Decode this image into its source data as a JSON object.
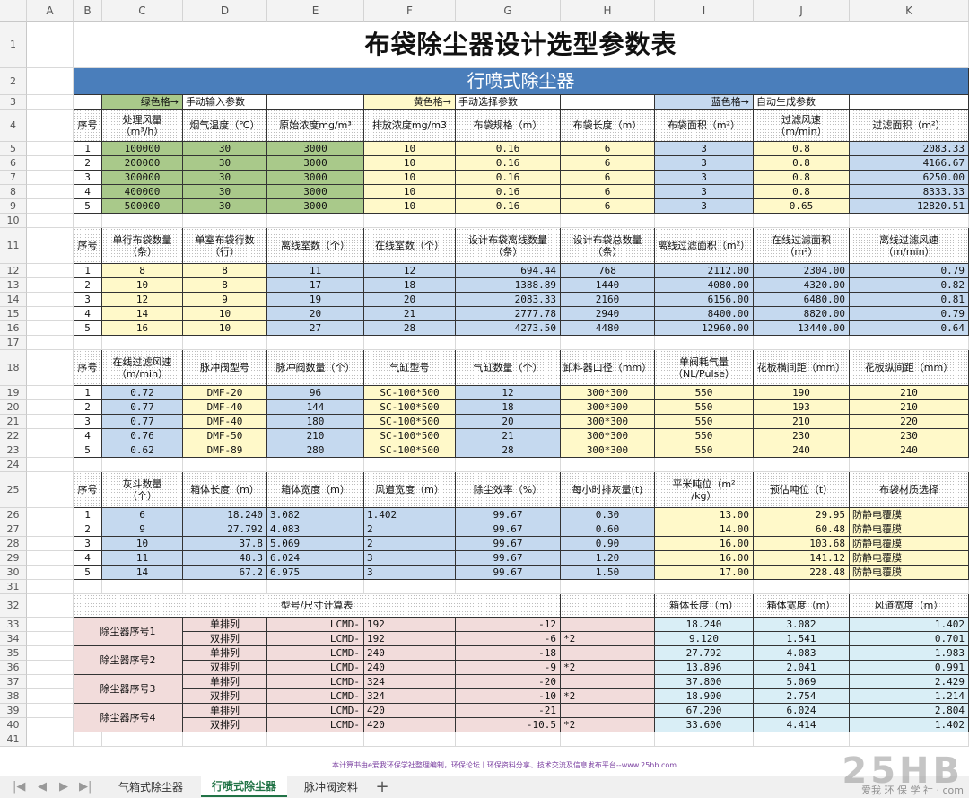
{
  "columns": [
    "A",
    "B",
    "C",
    "D",
    "E",
    "F",
    "G",
    "H",
    "I",
    "J",
    "K"
  ],
  "rows": [
    "1",
    "2",
    "3",
    "4",
    "5",
    "6",
    "7",
    "8",
    "9",
    "10",
    "11",
    "12",
    "13",
    "14",
    "15",
    "16",
    "17",
    "18",
    "19",
    "20",
    "21",
    "22",
    "23",
    "24",
    "25",
    "26",
    "27",
    "28",
    "29",
    "30",
    "31",
    "32",
    "33",
    "34",
    "35",
    "36",
    "37",
    "38",
    "39",
    "40",
    "41"
  ],
  "title": "布袋除尘器设计选型参数表",
  "banner": "行喷式除尘器",
  "legend": {
    "green_label": "绿色格→",
    "green_text": "手动输入参数",
    "yellow_label": "黄色格→",
    "yellow_text": "手动选择参数",
    "blue_label": "蓝色格→",
    "blue_text": "自动生成参数"
  },
  "table1": {
    "headers": [
      "序号",
      "处理风量\n（m³/h）",
      "烟气温度（℃）",
      "原始浓度mg/m³",
      "排放浓度mg/m3",
      "布袋规格（m）",
      "布袋长度（m）",
      "布袋面积（m²）",
      "过滤风速\n（m/min）",
      "过滤面积（m²）"
    ],
    "rows": [
      [
        "1",
        "100000",
        "30",
        "3000",
        "10",
        "0.16",
        "6",
        "3",
        "0.8",
        "2083.33"
      ],
      [
        "2",
        "200000",
        "30",
        "3000",
        "10",
        "0.16",
        "6",
        "3",
        "0.8",
        "4166.67"
      ],
      [
        "3",
        "300000",
        "30",
        "3000",
        "10",
        "0.16",
        "6",
        "3",
        "0.8",
        "6250.00"
      ],
      [
        "4",
        "400000",
        "30",
        "3000",
        "10",
        "0.16",
        "6",
        "3",
        "0.8",
        "8333.33"
      ],
      [
        "5",
        "500000",
        "30",
        "3000",
        "10",
        "0.16",
        "6",
        "3",
        "0.65",
        "12820.51"
      ]
    ]
  },
  "table2": {
    "headers": [
      "序号",
      "单行布袋数量\n（条）",
      "单室布袋行数\n（行）",
      "离线室数（个）",
      "在线室数（个）",
      "设计布袋离线数量\n（条）",
      "设计布袋总数量\n（条）",
      "离线过滤面积（m²）",
      "在线过滤面积\n（m²）",
      "离线过滤风速\n（m/min）"
    ],
    "rows": [
      [
        "1",
        "8",
        "8",
        "11",
        "12",
        "694.44",
        "768",
        "2112.00",
        "2304.00",
        "0.79"
      ],
      [
        "2",
        "10",
        "8",
        "17",
        "18",
        "1388.89",
        "1440",
        "4080.00",
        "4320.00",
        "0.82"
      ],
      [
        "3",
        "12",
        "9",
        "19",
        "20",
        "2083.33",
        "2160",
        "6156.00",
        "6480.00",
        "0.81"
      ],
      [
        "4",
        "14",
        "10",
        "20",
        "21",
        "2777.78",
        "2940",
        "8400.00",
        "8820.00",
        "0.79"
      ],
      [
        "5",
        "16",
        "10",
        "27",
        "28",
        "4273.50",
        "4480",
        "12960.00",
        "13440.00",
        "0.64"
      ]
    ]
  },
  "table3": {
    "headers": [
      "序号",
      "在线过滤风速\n（m/min）",
      "脉冲阀型号",
      "脉冲阀数量（个）",
      "气缸型号",
      "气缸数量（个）",
      "卸料器口径（mm）",
      "单阀耗气量\n（NL/Pulse）",
      "花板横间距（mm）",
      "花板纵间距（mm）"
    ],
    "rows": [
      [
        "1",
        "0.72",
        "DMF-20",
        "96",
        "SC-100*500",
        "12",
        "300*300",
        "550",
        "190",
        "210"
      ],
      [
        "2",
        "0.77",
        "DMF-40",
        "144",
        "SC-100*500",
        "18",
        "300*300",
        "550",
        "193",
        "210"
      ],
      [
        "3",
        "0.77",
        "DMF-40",
        "180",
        "SC-100*500",
        "20",
        "300*300",
        "550",
        "210",
        "220"
      ],
      [
        "4",
        "0.76",
        "DMF-50",
        "210",
        "SC-100*500",
        "21",
        "300*300",
        "550",
        "230",
        "230"
      ],
      [
        "5",
        "0.62",
        "DMF-89",
        "280",
        "SC-100*500",
        "28",
        "300*300",
        "550",
        "240",
        "240"
      ]
    ]
  },
  "table4": {
    "headers": [
      "序号",
      "灰斗数量\n（个）",
      "箱体长度（m）",
      "箱体宽度（m）",
      "风道宽度（m）",
      "除尘效率（%）",
      "每小时排灰量(t)",
      "平米吨位（m²\n/kg）",
      "预估吨位（t）",
      "布袋材质选择"
    ],
    "rows": [
      [
        "1",
        "6",
        "18.240",
        "3.082",
        "1.402",
        "99.67",
        "0.30",
        "13.00",
        "29.95",
        "防静电覆膜"
      ],
      [
        "2",
        "9",
        "27.792",
        "4.083",
        "2",
        "99.67",
        "0.60",
        "14.00",
        "60.48",
        "防静电覆膜"
      ],
      [
        "3",
        "10",
        "37.8",
        "5.069",
        "2",
        "99.67",
        "0.90",
        "16.00",
        "103.68",
        "防静电覆膜"
      ],
      [
        "4",
        "11",
        "48.3",
        "6.024",
        "3",
        "99.67",
        "1.20",
        "16.00",
        "141.12",
        "防静电覆膜"
      ],
      [
        "5",
        "14",
        "67.2",
        "6.975",
        "3",
        "99.67",
        "1.50",
        "17.00",
        "228.48",
        "防静电覆膜"
      ]
    ]
  },
  "table5": {
    "header_title": "型号/尺寸计算表",
    "header_cols": [
      "箱体长度（m）",
      "箱体宽度（m）",
      "风道宽度（m）"
    ],
    "groups": [
      {
        "name": "除尘器序号1",
        "rows": [
          {
            "type": "单排列",
            "model": "LCMD-",
            "size": "192",
            "delta": "-12",
            "mult": "",
            "len": "18.240",
            "wid": "3.082",
            "duct": "1.402"
          },
          {
            "type": "双排列",
            "model": "LCMD-",
            "size": "192",
            "delta": "-6",
            "mult": "*2",
            "len": "9.120",
            "wid": "1.541",
            "duct": "0.701"
          }
        ]
      },
      {
        "name": "除尘器序号2",
        "rows": [
          {
            "type": "单排列",
            "model": "LCMD-",
            "size": "240",
            "delta": "-18",
            "mult": "",
            "len": "27.792",
            "wid": "4.083",
            "duct": "1.983"
          },
          {
            "type": "双排列",
            "model": "LCMD-",
            "size": "240",
            "delta": "-9",
            "mult": "*2",
            "len": "13.896",
            "wid": "2.041",
            "duct": "0.991"
          }
        ]
      },
      {
        "name": "除尘器序号3",
        "rows": [
          {
            "type": "单排列",
            "model": "LCMD-",
            "size": "324",
            "delta": "-20",
            "mult": "",
            "len": "37.800",
            "wid": "5.069",
            "duct": "2.429"
          },
          {
            "type": "双排列",
            "model": "LCMD-",
            "size": "324",
            "delta": "-10",
            "mult": "*2",
            "len": "18.900",
            "wid": "2.754",
            "duct": "1.214"
          }
        ]
      },
      {
        "name": "除尘器序号4",
        "rows": [
          {
            "type": "单排列",
            "model": "LCMD-",
            "size": "420",
            "delta": "-21",
            "mult": "",
            "len": "67.200",
            "wid": "6.024",
            "duct": "2.804"
          },
          {
            "type": "双排列",
            "model": "LCMD-",
            "size": "420",
            "delta": "-10.5",
            "mult": "*2",
            "len": "33.600",
            "wid": "4.414",
            "duct": "1.402"
          }
        ]
      }
    ]
  },
  "footer_note": "本计算书由e爱我环保学社整理编制，环保论坛丨环保资料分享、技术交流及信息发布平台--www.25hb.com",
  "sheet_tabs": [
    "气箱式除尘器",
    "行喷式除尘器",
    "脉冲阀资料"
  ],
  "active_tab": "行喷式除尘器",
  "watermark": "25HB",
  "watermark_sub": "爱我 环 保 学 社 · com"
}
